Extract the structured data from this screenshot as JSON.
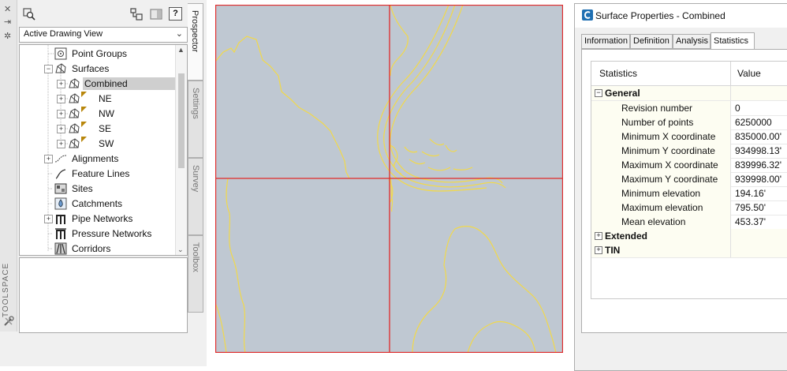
{
  "toolspace": {
    "side_label": "TOOLSPACE",
    "dropdown_value": "Active Drawing View",
    "tabs": [
      "Prospector",
      "Settings",
      "Survey",
      "Toolbox"
    ],
    "tree": {
      "point_groups": "Point Groups",
      "surfaces": "Surfaces",
      "combined": "Combined",
      "ne": "NE",
      "nw": "NW",
      "se": "SE",
      "sw": "SW",
      "alignments": "Alignments",
      "feature_lines": "Feature Lines",
      "sites": "Sites",
      "catchments": "Catchments",
      "pipe_networks": "Pipe Networks",
      "pressure_networks": "Pressure Networks",
      "corridors": "Corridors"
    },
    "help_label": "?"
  },
  "dialog": {
    "title": "Surface Properties - Combined",
    "tabs": [
      "Information",
      "Definition",
      "Analysis",
      "Statistics"
    ],
    "active_tab": "Statistics",
    "grid": {
      "col_statistics": "Statistics",
      "col_value": "Value",
      "general_label": "General",
      "extended_label": "Extended",
      "tin_label": "TIN",
      "rows": [
        {
          "name": "Revision number",
          "value": "0"
        },
        {
          "name": "Number of points",
          "value": "6250000"
        },
        {
          "name": "Minimum X coordinate",
          "value": "835000.00'"
        },
        {
          "name": "Minimum Y coordinate",
          "value": "934998.13'"
        },
        {
          "name": "Maximum X coordinate",
          "value": "839996.32'"
        },
        {
          "name": "Maximum Y coordinate",
          "value": "939998.00'"
        },
        {
          "name": "Minimum elevation",
          "value": "194.16'"
        },
        {
          "name": "Maximum elevation",
          "value": "795.50'"
        },
        {
          "name": "Mean elevation",
          "value": "453.37'"
        }
      ]
    }
  },
  "colors": {
    "drawing_bg": "#bfc8d2",
    "contour": "#f2d94a",
    "tile_border": "#e02a2a",
    "selection": "#cfcfcf"
  }
}
